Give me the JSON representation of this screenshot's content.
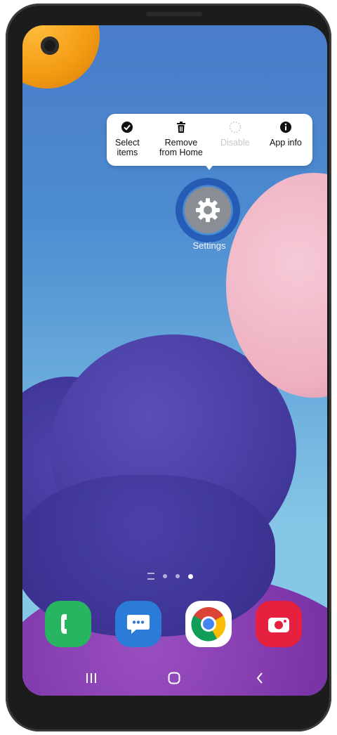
{
  "popup_menu": {
    "items": [
      {
        "label_line1": "Select",
        "label_line2": "items",
        "icon": "check-circle-icon",
        "enabled": true
      },
      {
        "label_line1": "Remove",
        "label_line2": "from Home",
        "icon": "trash-icon",
        "enabled": true
      },
      {
        "label_line1": "Disable",
        "label_line2": "",
        "icon": "dashed-circle-icon",
        "enabled": false
      },
      {
        "label_line1": "App info",
        "label_line2": "",
        "icon": "info-icon",
        "enabled": true
      }
    ]
  },
  "home": {
    "settings_label": "Settings"
  },
  "page_indicator": {
    "pages": 3,
    "active_index": 2
  },
  "dock": [
    {
      "name": "Phone",
      "icon": "phone-icon",
      "color": "#27b561"
    },
    {
      "name": "Messages",
      "icon": "message-icon",
      "color": "#2b7bd8"
    },
    {
      "name": "Chrome",
      "icon": "chrome-icon",
      "color": "#ffffff"
    },
    {
      "name": "Camera",
      "icon": "camera-icon",
      "color": "#e6213f"
    }
  ],
  "nav_bar": {
    "recents": "recents-icon",
    "home": "home-icon",
    "back": "back-icon"
  },
  "colors": {
    "wallpaper_top": "#4a7cc9",
    "wallpaper_bottom": "#86c8e6"
  }
}
